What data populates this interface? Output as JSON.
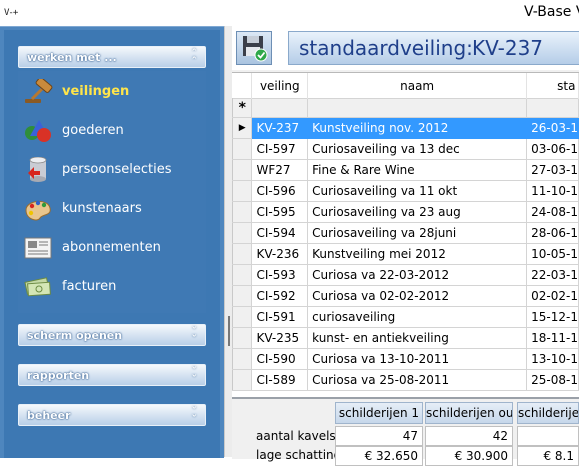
{
  "window": {
    "title": "V-Base V",
    "app_icon_text": "V-+"
  },
  "sidebar": {
    "groups": [
      {
        "label": "werken met ...",
        "chevron": "up",
        "expanded": true
      },
      {
        "label": "scherm openen",
        "chevron": "down",
        "expanded": false
      },
      {
        "label": "rapporten",
        "chevron": "down",
        "expanded": false
      },
      {
        "label": "beheer",
        "chevron": "down",
        "expanded": false
      }
    ],
    "items": [
      {
        "label": "veilingen",
        "icon": "gavel-icon",
        "active": true
      },
      {
        "label": "goederen",
        "icon": "shapes-icon",
        "active": false
      },
      {
        "label": "persoonselecties",
        "icon": "database-icon",
        "active": false
      },
      {
        "label": "kunstenaars",
        "icon": "palette-icon",
        "active": false
      },
      {
        "label": "abonnementen",
        "icon": "newspaper-icon",
        "active": false
      },
      {
        "label": "facturen",
        "icon": "money-icon",
        "active": false
      }
    ]
  },
  "header": {
    "title_label": "standaardveiling:",
    "title_code": "KV-237"
  },
  "grid": {
    "columns": [
      "veiling",
      "naam",
      "sta"
    ],
    "new_row_marker": "*",
    "current_row_marker": "▶",
    "rows": [
      {
        "veiling": "KV-237",
        "naam": "Kunstveiling nov. 2012",
        "datum": "26-03-1",
        "selected": true
      },
      {
        "veiling": "CI-597",
        "naam": "Curiosaveiling va 13 dec",
        "datum": "03-06-1",
        "selected": false
      },
      {
        "veiling": "WF27",
        "naam": "Fine & Rare Wine",
        "datum": "27-03-1",
        "selected": false
      },
      {
        "veiling": "CI-596",
        "naam": "Curiosaveiling va 11 okt",
        "datum": "11-10-1",
        "selected": false
      },
      {
        "veiling": "CI-595",
        "naam": "Curiosaveiling va 23 aug",
        "datum": "24-08-1",
        "selected": false
      },
      {
        "veiling": "CI-594",
        "naam": "Curiosaveiling va 28juni",
        "datum": "28-06-1",
        "selected": false
      },
      {
        "veiling": "KV-236",
        "naam": "Kunstveiling mei 2012",
        "datum": "10-05-1",
        "selected": false
      },
      {
        "veiling": "CI-593",
        "naam": "Curiosa va 22-03-2012",
        "datum": "22-03-1",
        "selected": false
      },
      {
        "veiling": "CI-592",
        "naam": "Curiosa va 02-02-2012",
        "datum": "02-02-1",
        "selected": false
      },
      {
        "veiling": "CI-591",
        "naam": "curiosaveiling",
        "datum": "15-12-1",
        "selected": false
      },
      {
        "veiling": "KV-235",
        "naam": "kunst- en antiekveiling",
        "datum": "18-11-1",
        "selected": false
      },
      {
        "veiling": "CI-590",
        "naam": "Curiosa va 13-10-2011",
        "datum": "13-10-1",
        "selected": false
      },
      {
        "veiling": "CI-589",
        "naam": "Curiosa va 25-08-2011",
        "datum": "25-08-1",
        "selected": false
      }
    ]
  },
  "summary": {
    "row_labels": [
      "aantal kavels",
      "lage schatting"
    ],
    "columns": [
      {
        "header": "schilderijen 1",
        "aantal": "47",
        "schatting": "€ 32.650"
      },
      {
        "header": "schilderijen ou",
        "aantal": "42",
        "schatting": "€ 30.900"
      },
      {
        "header": "schilderijen",
        "aantal": "",
        "schatting": "€ 8.1"
      }
    ]
  },
  "colors": {
    "sidebar_bg": "#3d78b3",
    "active_item": "#ffe54a",
    "selection": "#3399ff",
    "title_text": "#1f3f8a"
  }
}
